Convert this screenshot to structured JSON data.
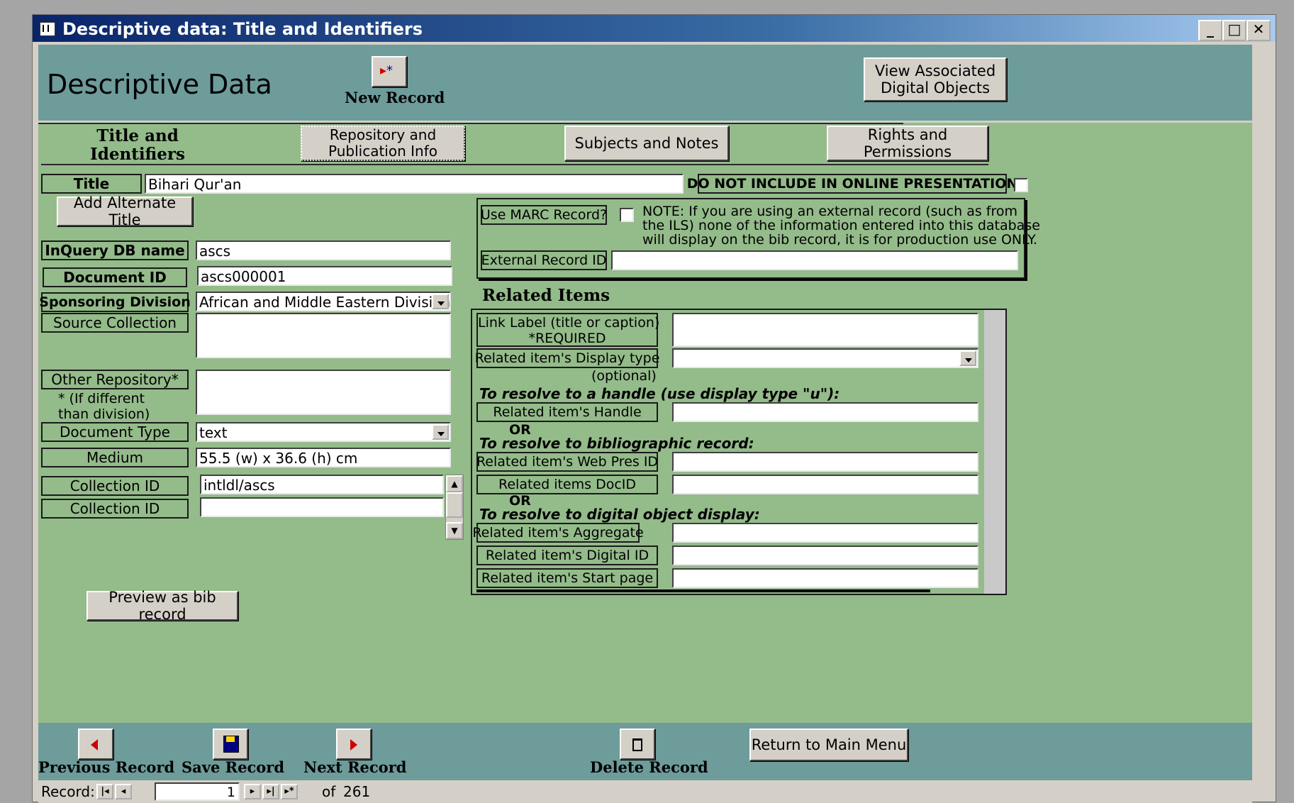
{
  "window": {
    "title": "Descriptive data: Title and Identifiers"
  },
  "header": {
    "heading": "Descriptive Data",
    "new_record_label": "New Record",
    "view_digital_objects_label": "View Associated Digital Objects"
  },
  "section_tabs": {
    "current": "Title and Identifiers",
    "repository_label": "Repository and Publication Info",
    "subjects_label": "Subjects and Notes",
    "rights_label": "Rights and Permissions"
  },
  "fields": {
    "title_label": "Title",
    "title_value": "Bihari  Qur'an",
    "do_not_include_label": "DO NOT INCLUDE IN ONLINE PRESENTATION",
    "add_alternate_title": "Add Alternate Title",
    "inquery_label": "InQuery DB name",
    "inquery_value": "ascs",
    "document_id_label": "Document ID",
    "document_id_value": "ascs000001",
    "sponsoring_label": "Sponsoring Division",
    "sponsoring_value": "African and Middle Eastern Division",
    "source_collection_label": "Source Collection",
    "source_collection_value": "",
    "other_repository_label": "Other Repository*",
    "other_repository_note_1": "* (If different",
    "other_repository_note_2": "than division)",
    "other_repository_value": "",
    "document_type_label": "Document Type",
    "document_type_value": "text",
    "medium_label": "Medium",
    "medium_value": "55.5 (w) x 36.6 (h) cm",
    "collection_id_label": "Collection ID",
    "collection_ids": [
      "intldl/ascs",
      ""
    ],
    "preview_label": "Preview as bib record"
  },
  "marc": {
    "use_marc_label": "Use MARC Record?",
    "note_line_1": "NOTE: If you are using an external record (such as from",
    "note_line_2": "the ILS) none of the information entered into this database",
    "note_line_3": "will display on the bib record, it is for production use ONLY.",
    "external_id_label": "External Record ID",
    "external_id_value": ""
  },
  "related": {
    "heading": "Related Items",
    "link_label_1": "Link Label (title or caption)",
    "link_label_2": "*REQUIRED",
    "display_type_label": "Related item's Display type",
    "optional": "(optional)",
    "handle_hint": "To resolve to a handle (use display type \"u\"):",
    "handle_label": "Related item's Handle",
    "or_1": "OR",
    "bib_hint": "To resolve to bibliographic record:",
    "web_pres_label": "Related item's Web Pres ID",
    "docid_label": "Related items DocID",
    "or_2": "OR",
    "digital_hint": "To resolve to digital object display:",
    "aggregate_label": "Related item's Aggregate",
    "digital_id_label": "Related item's Digital ID",
    "start_page_label": "Related item's Start page"
  },
  "footer": {
    "previous_label": "Previous Record",
    "save_label": "Save Record",
    "next_label": "Next Record",
    "delete_label": "Delete Record",
    "return_label": "Return to Main Menu"
  },
  "record_nav": {
    "label": "Record:",
    "current": "1",
    "of_label": "of",
    "total": "261"
  }
}
